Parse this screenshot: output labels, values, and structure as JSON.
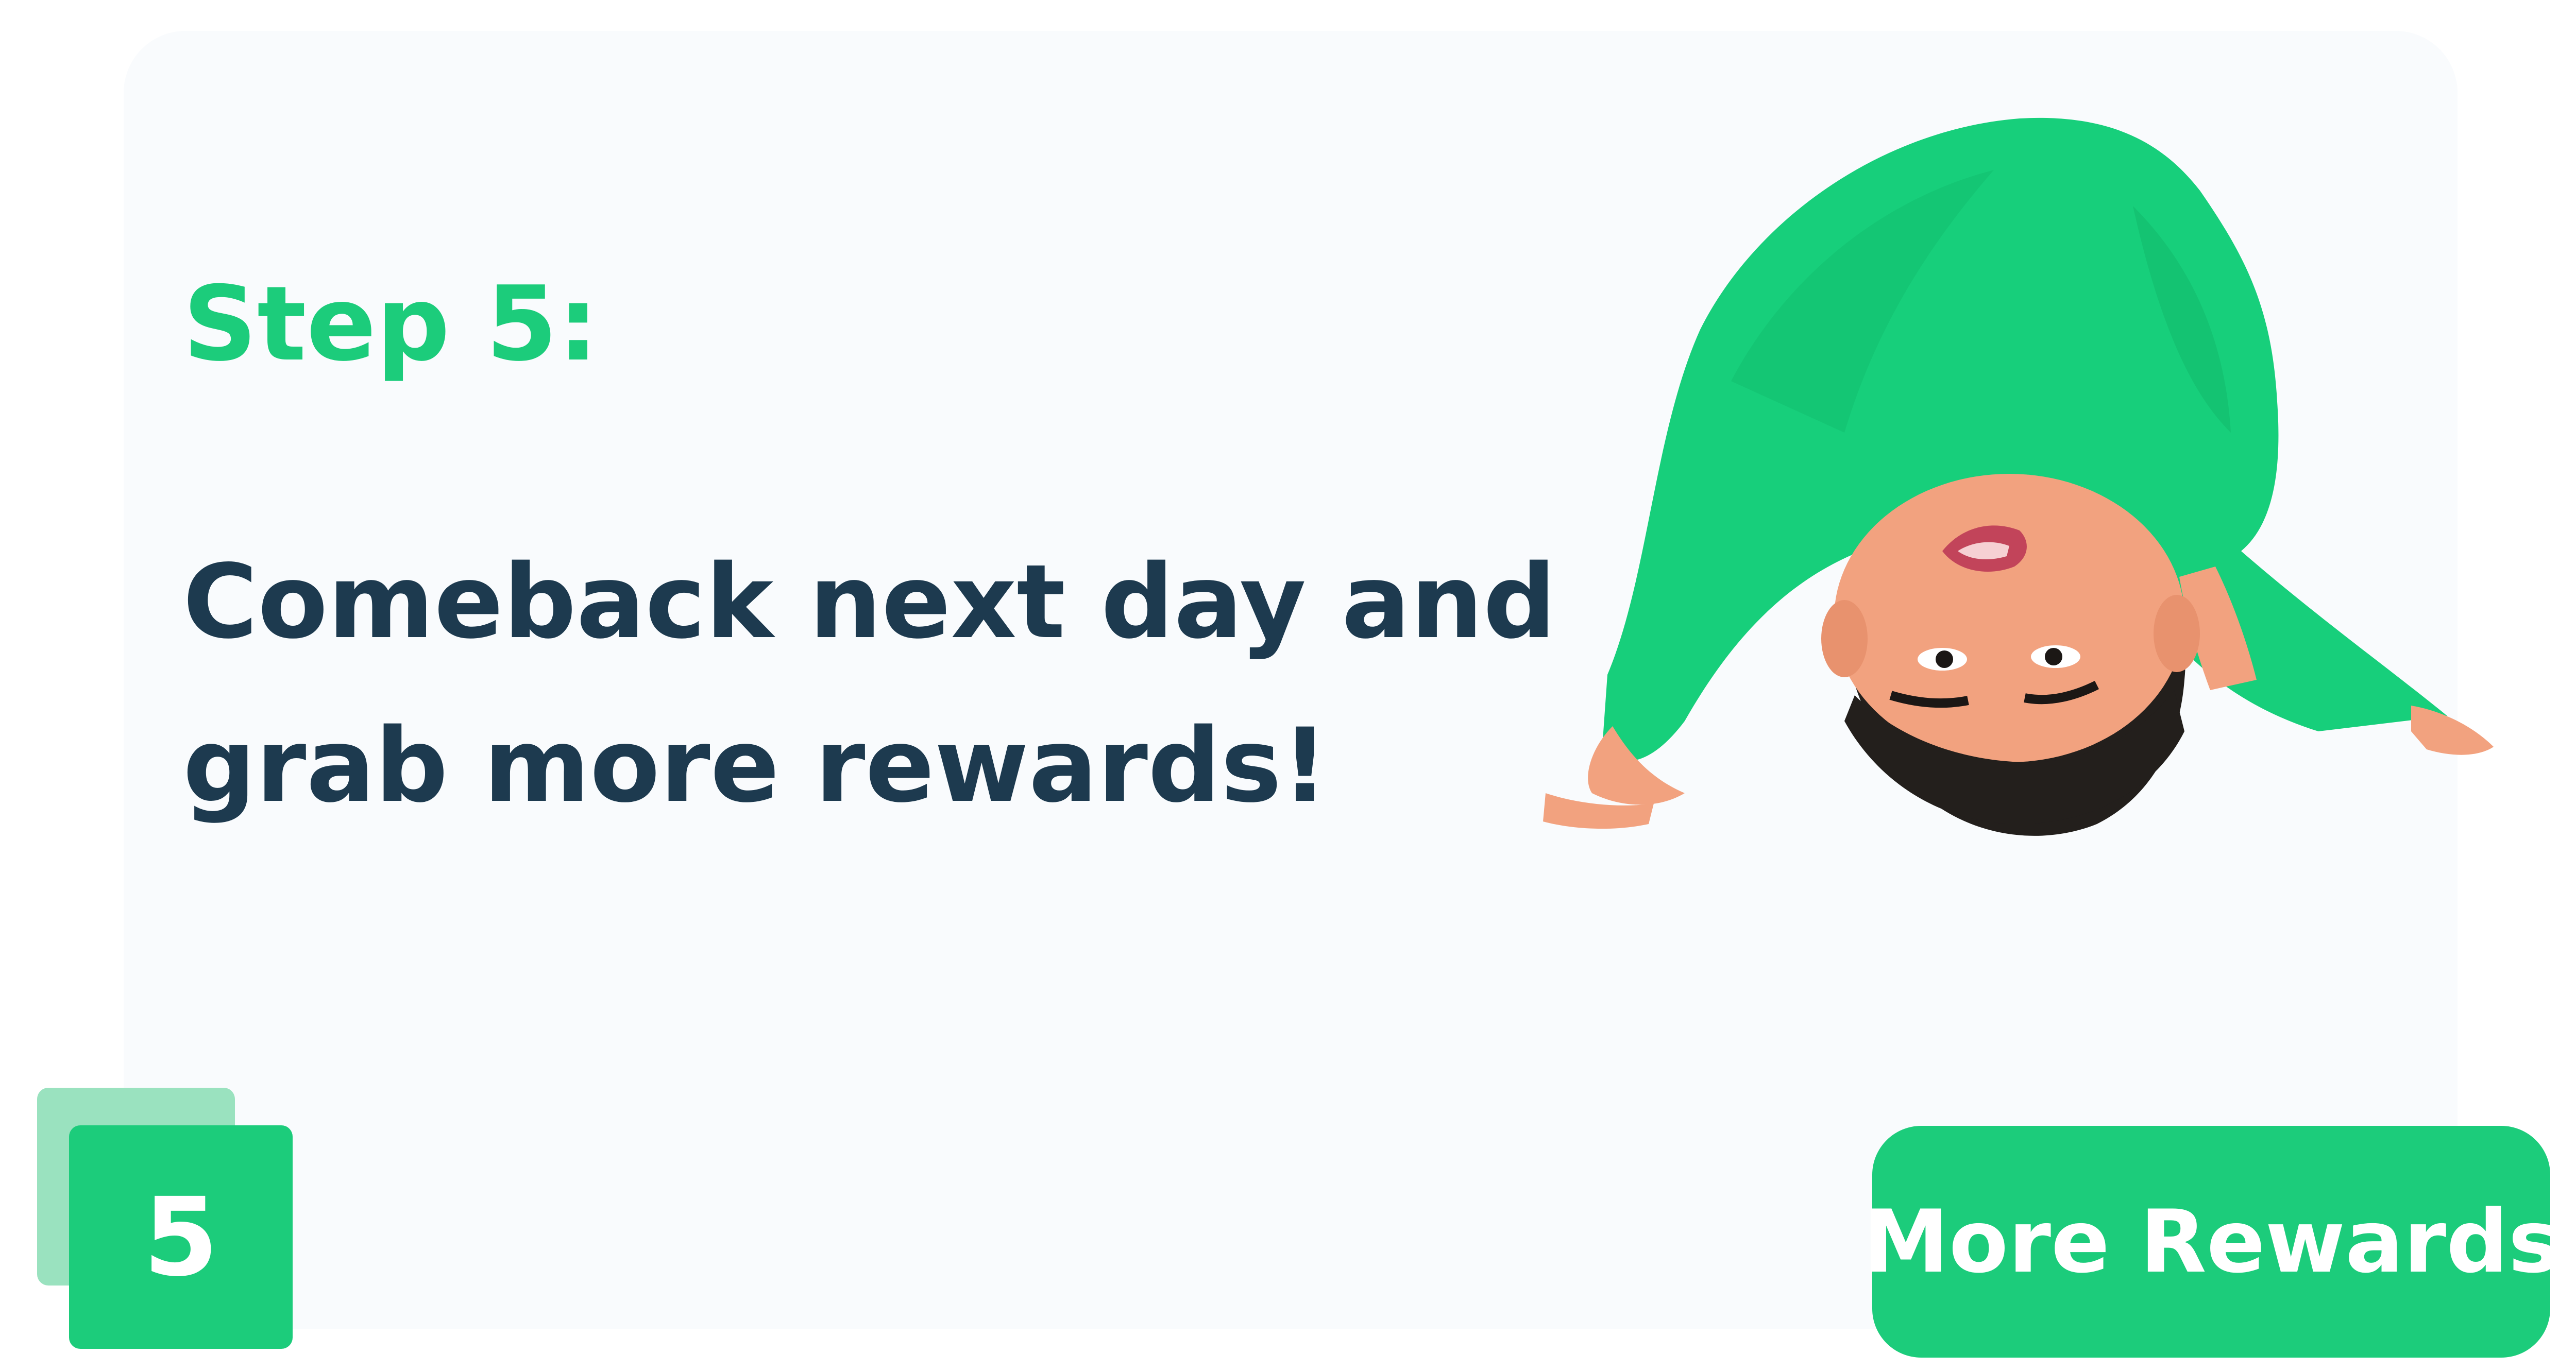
{
  "step": {
    "label": "Step 5:",
    "title_line1": "Comeback next day and",
    "title_line2": "grab more rewards!"
  },
  "badge": {
    "number": "5"
  },
  "cta": {
    "label": "More Rewards"
  },
  "colors": {
    "accent": "#1ccc7b",
    "accent_light": "#9ae2bf",
    "heading": "#1d3a4f",
    "card_background": "#f9fbfd"
  },
  "illustration": {
    "name": "upside-down-person-illustration"
  }
}
